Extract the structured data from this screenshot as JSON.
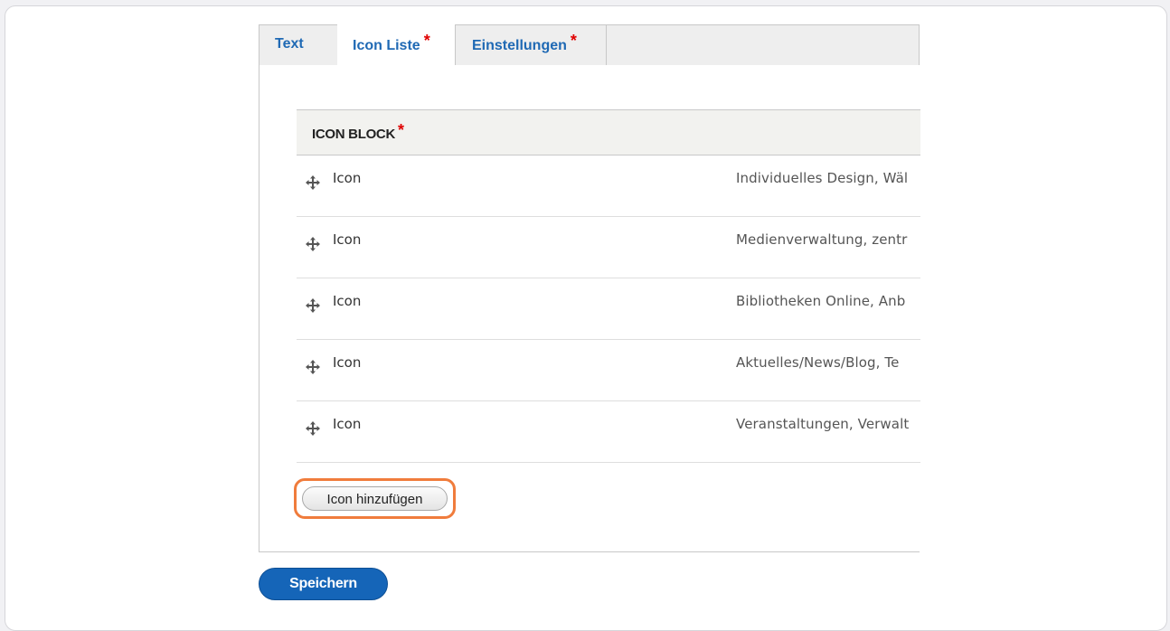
{
  "tabs": [
    {
      "label": "Text",
      "required": ""
    },
    {
      "label": "Icon Liste",
      "required": "*"
    },
    {
      "label": "Einstellungen",
      "required": "*"
    }
  ],
  "table": {
    "header": "ICON BLOCK",
    "required": "*",
    "rows": [
      {
        "label": "Icon",
        "summary": "Individuelles Design, Wäl"
      },
      {
        "label": "Icon",
        "summary": "Medienverwaltung, zentr"
      },
      {
        "label": "Icon",
        "summary": "Bibliotheken Online, Anb"
      },
      {
        "label": "Icon",
        "summary": "Aktuelles/News/Blog, Te"
      },
      {
        "label": "Icon",
        "summary": "Veranstaltungen, Verwalt"
      }
    ]
  },
  "add_button": "Icon hinzufügen",
  "save_button": "Speichern",
  "colors": {
    "link_blue": "#1f69b4",
    "required_red": "#e00000",
    "highlight_orange": "#f07c3c",
    "primary_blue": "#1565b8"
  }
}
